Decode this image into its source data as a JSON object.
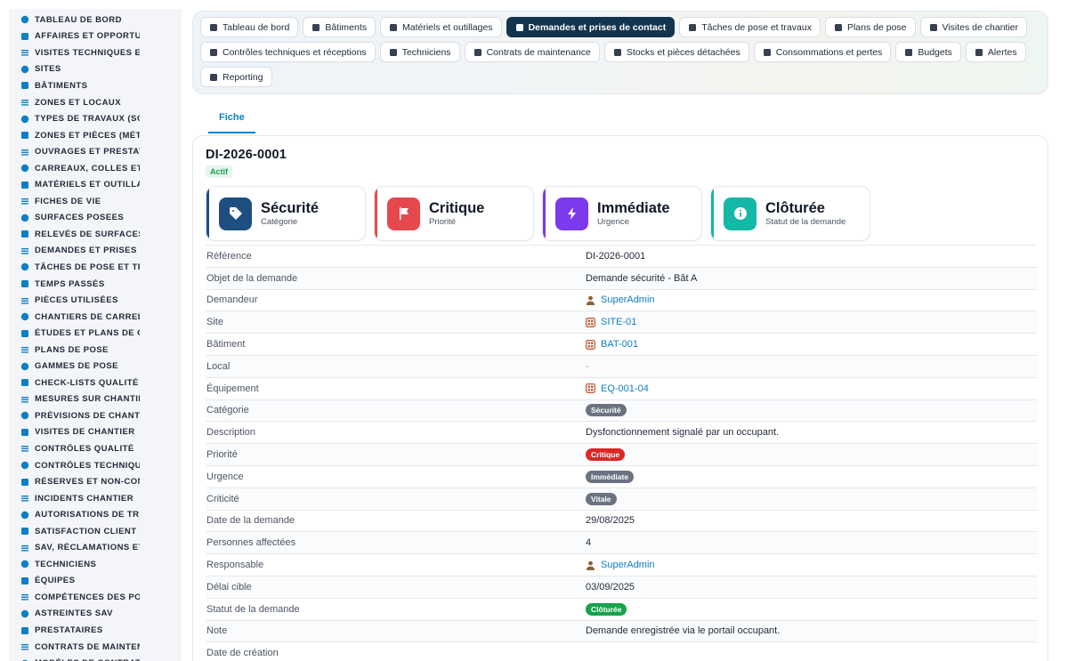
{
  "sidebar": {
    "items": [
      {
        "label": "TABLEAU DE BORD",
        "icon": "dashboard-icon"
      },
      {
        "label": "AFFAIRES ET OPPORTUNITÉS",
        "icon": "target-icon"
      },
      {
        "label": "VISITES TECHNIQUES ET DIAGNOSTICS",
        "icon": "ruler-icon"
      },
      {
        "label": "SITES",
        "icon": "map-pin-icon"
      },
      {
        "label": "BÂTIMENTS",
        "icon": "building-icon"
      },
      {
        "label": "ZONES ET LOCAUX",
        "icon": "grid-icon"
      },
      {
        "label": "TYPES DE TRAVAUX (SOLS)",
        "icon": "sitemap-icon"
      },
      {
        "label": "ZONES ET PIÈCES (MÉTRÉS)",
        "icon": "grid-icon"
      },
      {
        "label": "OUVRAGES ET PRESTATIONS",
        "icon": "brush-icon"
      },
      {
        "label": "CARREAUX, COLLES ET JOINTS",
        "icon": "lines-icon"
      },
      {
        "label": "MATÉRIELS ET OUTILLAGE",
        "icon": "gears-icon"
      },
      {
        "label": "FICHES DE VIE",
        "icon": "history-icon"
      },
      {
        "label": "SURFACES POSEES",
        "icon": "layers-icon"
      },
      {
        "label": "RELEVÉS DE SURFACES",
        "icon": "clipboard-icon"
      },
      {
        "label": "DEMANDES ET PRISES DE CONTACT",
        "icon": "question-icon"
      },
      {
        "label": "TÂCHES DE POSE ET TRAVAUX",
        "icon": "clipboard-check-icon"
      },
      {
        "label": "TEMPS PASSÉS",
        "icon": "clock-icon"
      },
      {
        "label": "PIÈCES UTILISÉES",
        "icon": "box-icon"
      },
      {
        "label": "CHANTIERS DE CARRELAGE",
        "icon": "hammer-icon"
      },
      {
        "label": "ÉTUDES ET PLANS DE CALEPINAGE",
        "icon": "pencil-ruler-icon"
      },
      {
        "label": "PLANS DE POSE",
        "icon": "calendar-icon"
      },
      {
        "label": "GAMMES DE POSE",
        "icon": "list-icon"
      },
      {
        "label": "CHECK-LISTS QUALITÉ",
        "icon": "checklist-icon"
      },
      {
        "label": "MESURES SUR CHANTIER",
        "icon": "clipboard-icon"
      },
      {
        "label": "PRÉVISIONS DE CHANTIER",
        "icon": "chart-line-icon"
      },
      {
        "label": "VISITES DE CHANTIER",
        "icon": "walk-icon"
      },
      {
        "label": "CONTRÔLES QUALITÉ",
        "icon": "search-icon"
      },
      {
        "label": "CONTRÔLES TECHNIQUES ET RÉCEPTIONS",
        "icon": "clipboard-check-icon"
      },
      {
        "label": "RÉSERVES ET NON-CONFORMITÉS",
        "icon": "info-icon"
      },
      {
        "label": "INCIDENTS CHANTIER",
        "icon": "warning-icon"
      },
      {
        "label": "AUTORISATIONS DE TRAVAUX",
        "icon": "file-signature-icon"
      },
      {
        "label": "SATISFACTION CLIENT",
        "icon": "smile-icon"
      },
      {
        "label": "SAV, RÉCLAMATIONS ET GARANTIES",
        "icon": "comment-icon"
      },
      {
        "label": "TECHNICIENS",
        "icon": "hard-hat-icon"
      },
      {
        "label": "ÉQUIPES",
        "icon": "users-icon"
      },
      {
        "label": "COMPÉTENCES DES POSEURS",
        "icon": "gear-icon"
      },
      {
        "label": "ASTREINTES SAV",
        "icon": "phone-icon"
      },
      {
        "label": "PRESTATAIRES",
        "icon": "handshake-icon"
      },
      {
        "label": "CONTRATS DE MAINTENANCE",
        "icon": "file-icon"
      },
      {
        "label": "MODÈLES DE CONTRATS",
        "icon": "file-icon"
      }
    ]
  },
  "topnav": {
    "tabs": [
      {
        "label": "Tableau de bord",
        "icon": "gauge-icon",
        "active": false
      },
      {
        "label": "Bâtiments",
        "icon": "building-icon",
        "active": false
      },
      {
        "label": "Matériels et outillages",
        "icon": "gears-icon",
        "active": false
      },
      {
        "label": "Demandes et prises de contact",
        "icon": "question-icon",
        "active": true
      },
      {
        "label": "Tâches de pose et travaux",
        "icon": "clipboard-check-icon",
        "active": false
      },
      {
        "label": "Plans de pose",
        "icon": "calendar-icon",
        "active": false
      },
      {
        "label": "Visites de chantier",
        "icon": "route-icon",
        "active": false
      },
      {
        "label": "Contrôles techniques et réceptions",
        "icon": "clipboard-check-icon",
        "active": false
      },
      {
        "label": "Techniciens",
        "icon": "hard-hat-icon",
        "active": false
      },
      {
        "label": "Contrats de maintenance",
        "icon": "file-icon",
        "active": false
      },
      {
        "label": "Stocks et pièces détachées",
        "icon": "boxes-icon",
        "active": false
      },
      {
        "label": "Consommations et pertes",
        "icon": "bolt-icon",
        "active": false
      },
      {
        "label": "Budgets",
        "icon": "money-icon",
        "active": false
      },
      {
        "label": "Alertes",
        "icon": "bell-icon",
        "active": false
      },
      {
        "label": "Reporting",
        "icon": "pie-chart-icon",
        "active": false
      }
    ]
  },
  "subtabs": {
    "fiche": "Fiche"
  },
  "record": {
    "reference": "DI-2026-0001",
    "status": "Actif"
  },
  "kpis": [
    {
      "value": "Sécurité",
      "label": "Catégorie",
      "icon": "tag-icon",
      "color": "#1e4f80"
    },
    {
      "value": "Critique",
      "label": "Priorité",
      "icon": "flag-icon",
      "color": "#e5484d"
    },
    {
      "value": "Immédiate",
      "label": "Urgence",
      "icon": "bolt-icon",
      "color": "#7c3aed"
    },
    {
      "value": "Clôturée",
      "label": "Statut de la demande",
      "icon": "info-icon",
      "color": "#14b8a6"
    }
  ],
  "details": [
    {
      "key": "Référence",
      "value": "DI-2026-0001",
      "type": "text"
    },
    {
      "key": "Objet de la demande",
      "value": "Demande sécurité - Bât A",
      "type": "text"
    },
    {
      "key": "Demandeur",
      "value": "SuperAdmin",
      "type": "user"
    },
    {
      "key": "Site",
      "value": "SITE-01",
      "type": "entity"
    },
    {
      "key": "Bâtiment",
      "value": "BAT-001",
      "type": "entity"
    },
    {
      "key": "Local",
      "value": "-",
      "type": "empty"
    },
    {
      "key": "Équipement",
      "value": "EQ-001-04",
      "type": "entity"
    },
    {
      "key": "Catégorie",
      "value": "Sécurité",
      "type": "badge",
      "color": "#6b7280"
    },
    {
      "key": "Description",
      "value": "Dysfonctionnement signalé par un occupant.",
      "type": "text"
    },
    {
      "key": "Priorité",
      "value": "Critique",
      "type": "badge",
      "color": "#dc2626"
    },
    {
      "key": "Urgence",
      "value": "Immédiate",
      "type": "badge",
      "color": "#6b7280"
    },
    {
      "key": "Criticité",
      "value": "Vitale",
      "type": "badge",
      "color": "#6b7280"
    },
    {
      "key": "Date de la demande",
      "value": "29/08/2025",
      "type": "text"
    },
    {
      "key": "Personnes affectées",
      "value": "4",
      "type": "text"
    },
    {
      "key": "Responsable",
      "value": "SuperAdmin",
      "type": "user"
    },
    {
      "key": "Délai cible",
      "value": "03/09/2025",
      "type": "text"
    },
    {
      "key": "Statut de la demande",
      "value": "Clôturée",
      "type": "badge",
      "color": "#16a34a"
    },
    {
      "key": "Note",
      "value": "Demande enregistrée via le portail occupant.",
      "type": "text"
    },
    {
      "key": "Date de création",
      "value": "",
      "type": "text"
    }
  ],
  "colors": {
    "accent": "#0e7fc4",
    "active_tab": "#12344f",
    "success": "#16a34a"
  }
}
